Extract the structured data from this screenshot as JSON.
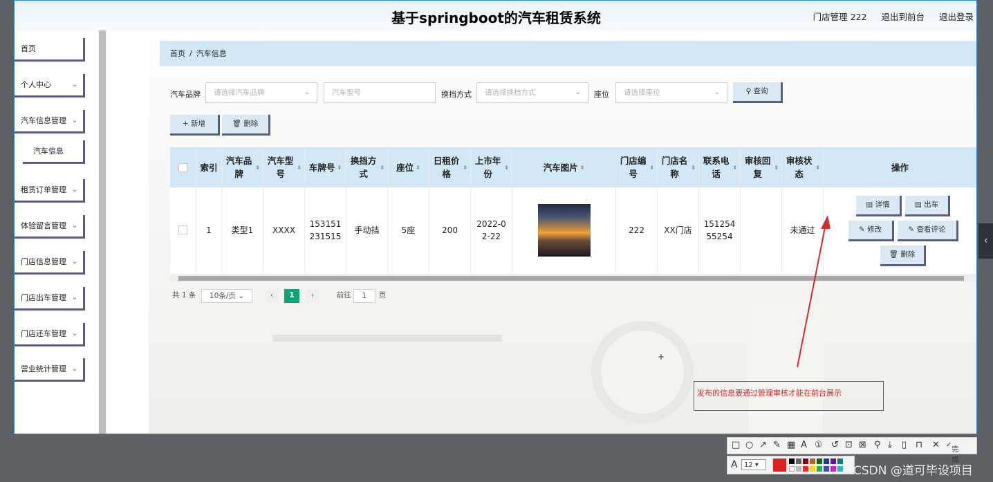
{
  "header": {
    "title": "基于springboot的汽车租赁系统",
    "links": [
      "门店管理 222",
      "退出到前台",
      "退出登录"
    ]
  },
  "sidebar": {
    "items": [
      {
        "label": "首页",
        "has_chevron": false
      },
      {
        "label": "个人中心",
        "has_chevron": true
      },
      {
        "label": "汽车信息管理",
        "has_chevron": true
      },
      {
        "label": "汽车信息",
        "sub": true
      },
      {
        "label": "租赁订单管理",
        "has_chevron": true
      },
      {
        "label": "体验留言管理",
        "has_chevron": true
      },
      {
        "label": "门店信息管理",
        "has_chevron": true
      },
      {
        "label": "门店出车管理",
        "has_chevron": true
      },
      {
        "label": "门店还车管理",
        "has_chevron": true
      },
      {
        "label": "营业统计管理",
        "has_chevron": true
      }
    ]
  },
  "breadcrumb": {
    "home": "首页",
    "sep": "/",
    "current": "汽车信息"
  },
  "filters": {
    "brand_label": "汽车品牌",
    "brand_placeholder": "请选择汽车品牌",
    "model_placeholder": "汽车型号",
    "gear_label": "换挡方式",
    "gear_placeholder": "请选择换挡方式",
    "seat_label": "座位",
    "seat_placeholder": "请选择座位",
    "search_button": "查询"
  },
  "actions": {
    "add": "新增",
    "delete": "删除"
  },
  "table": {
    "headers": [
      "索引",
      "汽车品牌",
      "汽车型号",
      "车牌号",
      "换挡方式",
      "座位",
      "日租价格",
      "上市年份",
      "汽车图片",
      "门店编号",
      "门店名称",
      "联系电话",
      "审核回复",
      "审核状态",
      "操作"
    ],
    "row": {
      "index": "1",
      "brand": "类型1",
      "model": "XXXX",
      "plate": "153151231515",
      "gear": "手动挡",
      "seat": "5座",
      "price": "200",
      "year": "2022-02-22",
      "store_no": "222",
      "store_name": "XX门店",
      "phone": "15125455254",
      "reply": "",
      "status": "未通过"
    },
    "row_buttons": {
      "detail": "详情",
      "out": "出车",
      "edit": "修改",
      "review": "查看评论",
      "delete": "删除"
    }
  },
  "pager": {
    "total": "共 1 条",
    "page_size": "10条/页",
    "current": "1",
    "goto": "前往",
    "goto_value": "1",
    "page_unit": "页"
  },
  "annotation": {
    "text": "发布的信息要通过管理审核才能在前台展示"
  },
  "screenshot_tool": {
    "font_size": "12",
    "finish": "完成"
  },
  "watermark": "CSDN @道可毕设项目",
  "colors": {
    "accent_bar": "#d2e8f6",
    "pager_active": "#0fa47a",
    "annotation": "#d42b2b"
  }
}
